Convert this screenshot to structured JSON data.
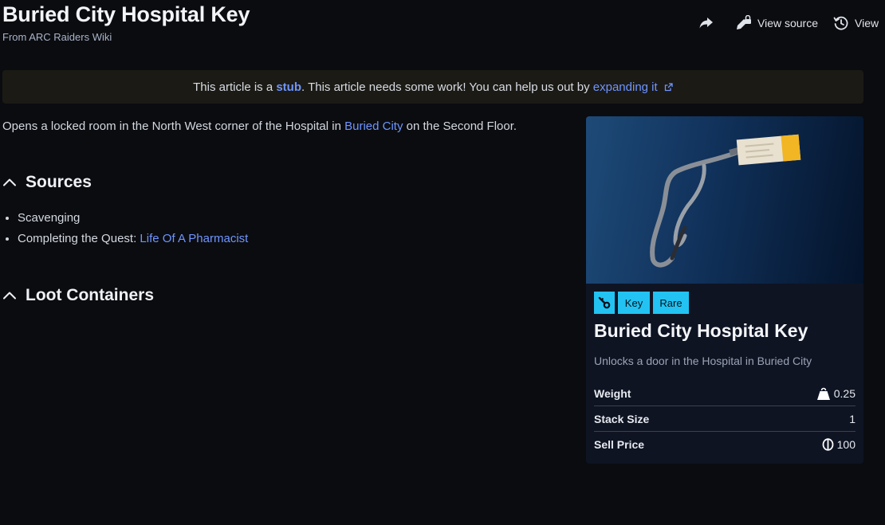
{
  "header": {
    "title": "Buried City Hospital Key",
    "subtitle": "From ARC Raiders Wiki",
    "actions": {
      "view_source": "View source",
      "view_history": "View"
    }
  },
  "notice": {
    "prefix": "This article is a ",
    "stub_link": "stub",
    "middle": ". This article needs some work! You can help us out by ",
    "expand_link": "expanding it"
  },
  "intro": {
    "before": "Opens a locked room in the North West corner of the Hospital in ",
    "link": "Buried City",
    "after": " on the Second Floor."
  },
  "sources": {
    "heading": "Sources",
    "items": [
      {
        "text": "Scavenging"
      },
      {
        "prefix": "Completing the Quest: ",
        "link": "Life Of A Pharmacist"
      }
    ]
  },
  "loot": {
    "heading": "Loot Containers"
  },
  "infobox": {
    "tags": [
      "Key",
      "Rare"
    ],
    "title": "Buried City Hospital Key",
    "description": "Unlocks a door in the Hospital in Buried City",
    "stats": [
      {
        "label": "Weight",
        "value": "0.25",
        "icon": "weight-icon"
      },
      {
        "label": "Stack Size",
        "value": "1"
      },
      {
        "label": "Sell Price",
        "value": "100",
        "icon": "coin-icon"
      }
    ]
  },
  "colors": {
    "background": "#0b0c10",
    "link": "#6f95ff",
    "tag": "#22c3f2",
    "notice_bg": "#1b1a15",
    "infobox_bg": "#0f1423"
  }
}
